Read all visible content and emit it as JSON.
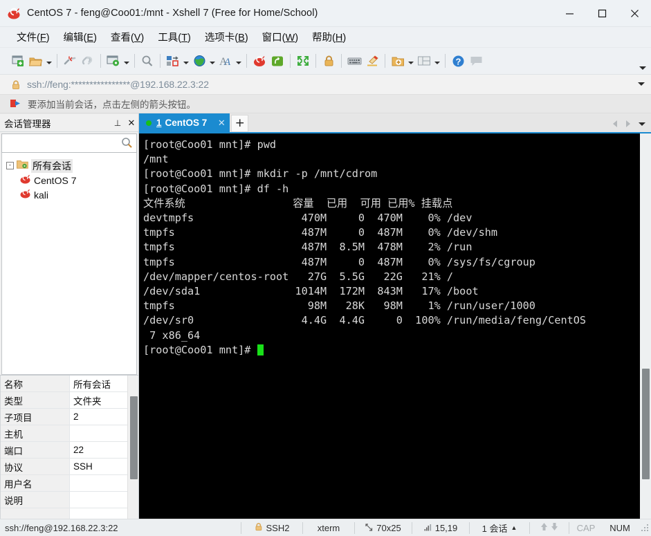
{
  "window": {
    "title": "CentOS 7 - feng@Coo01:/mnt - Xshell 7 (Free for Home/School)",
    "app_icon": "snail-icon",
    "minimize": "—",
    "maximize": "□",
    "close": "✕"
  },
  "menubar": {
    "items": [
      {
        "label": "文件(F)",
        "pre": "文件(",
        "key": "F",
        "post": ")"
      },
      {
        "label": "编辑(E)",
        "pre": "编辑(",
        "key": "E",
        "post": ")"
      },
      {
        "label": "查看(V)",
        "pre": "查看(",
        "key": "V",
        "post": ")"
      },
      {
        "label": "工具(T)",
        "pre": "工具(",
        "key": "T",
        "post": ")"
      },
      {
        "label": "选项卡(B)",
        "pre": "选项卡(",
        "key": "B",
        "post": ")"
      },
      {
        "label": "窗口(W)",
        "pre": "窗口(",
        "key": "W",
        "post": ")"
      },
      {
        "label": "帮助(H)",
        "pre": "帮助(",
        "key": "H",
        "post": ")"
      }
    ]
  },
  "toolbar": {
    "buttons": [
      "new-session-icon",
      "open-folder-icon",
      "open-folder-dropdown",
      "disconnect-icon",
      "reconnect-icon",
      "session-properties-icon",
      "session-properties-dropdown",
      "layout-arrange-icon",
      "layout-arrange-dropdown",
      "globe-encoding-icon",
      "globe-encoding-dropdown",
      "font-icon",
      "font-dropdown",
      "xshell-snail-icon",
      "xftp-icon",
      "fullscreen-icon",
      "lock-icon",
      "keyboard-icon",
      "highlight-pen-icon",
      "new-folder-icon",
      "new-folder-dropdown",
      "split-view-icon",
      "split-view-dropdown",
      "help-icon",
      "feedback-icon"
    ],
    "overflow_icon": "chevron-down-icon"
  },
  "address_bar": {
    "lock_icon": "lock-icon",
    "value": "ssh://feng:****************@192.168.22.3:22",
    "dropdown_icon": "chevron-down-icon"
  },
  "hint_bar": {
    "icon": "arrow-flag-icon",
    "text": "要添加当前会话，点击左侧的箭头按钮。"
  },
  "session_manager": {
    "header_title": "会话管理器",
    "pin_icon": "pin-icon",
    "close_icon": "close-icon",
    "search_placeholder": "",
    "search_value": "",
    "search_icon": "search-icon",
    "tree": {
      "root": {
        "label": "所有会话",
        "icon": "folder-sessions-icon",
        "expander": "-"
      },
      "children": [
        {
          "label": "CentOS 7",
          "icon": "snail-icon"
        },
        {
          "label": "kali",
          "icon": "snail-icon"
        }
      ]
    }
  },
  "properties": {
    "rows": [
      {
        "key": "名称",
        "value": "所有会话"
      },
      {
        "key": "类型",
        "value": "文件夹"
      },
      {
        "key": "子项目",
        "value": "2"
      },
      {
        "key": "主机",
        "value": ""
      },
      {
        "key": "端口",
        "value": "22"
      },
      {
        "key": "协议",
        "value": "SSH"
      },
      {
        "key": "用户名",
        "value": ""
      },
      {
        "key": "说明",
        "value": ""
      },
      {
        "key": "",
        "value": ""
      }
    ]
  },
  "tabs": {
    "items": [
      {
        "number": "1",
        "label": "CentOS 7",
        "status_dot": "#18c018",
        "close_icon": "✕",
        "active": true
      }
    ],
    "new_tab_label": "+",
    "nav_left_icon": "chevron-left-icon",
    "nav_right_icon": "chevron-right-icon",
    "tab_list_icon": "chevron-down-icon"
  },
  "terminal": {
    "prompt": "[root@Coo01 mnt]#",
    "lines": [
      "[root@Coo01 mnt]# pwd",
      "/mnt",
      "[root@Coo01 mnt]# mkdir -p /mnt/cdrom",
      "[root@Coo01 mnt]# df -h",
      "文件系统                 容量  已用  可用 已用% 挂载点",
      "devtmpfs                 470M     0  470M    0% /dev",
      "tmpfs                    487M     0  487M    0% /dev/shm",
      "tmpfs                    487M  8.5M  478M    2% /run",
      "tmpfs                    487M     0  487M    0% /sys/fs/cgroup",
      "/dev/mapper/centos-root   27G  5.5G   22G   21% /",
      "/dev/sda1               1014M  172M  843M   17% /boot",
      "tmpfs                     98M   28K   98M    1% /run/user/1000",
      "/dev/sr0                 4.4G  4.4G     0  100% /run/media/feng/CentOS",
      " 7 x86_64"
    ],
    "last_line": "[root@Coo01 mnt]# ",
    "cursor_color": "#19e019",
    "fg_color": "#d8d8d8",
    "bg_color": "#000000",
    "df_table": {
      "headers": [
        "文件系统",
        "容量",
        "已用",
        "可用",
        "已用%",
        "挂载点"
      ],
      "rows": [
        [
          "devtmpfs",
          "470M",
          "0",
          "470M",
          "0%",
          "/dev"
        ],
        [
          "tmpfs",
          "487M",
          "0",
          "487M",
          "0%",
          "/dev/shm"
        ],
        [
          "tmpfs",
          "487M",
          "8.5M",
          "478M",
          "2%",
          "/run"
        ],
        [
          "tmpfs",
          "487M",
          "0",
          "487M",
          "0%",
          "/sys/fs/cgroup"
        ],
        [
          "/dev/mapper/centos-root",
          "27G",
          "5.5G",
          "22G",
          "21%",
          "/"
        ],
        [
          "/dev/sda1",
          "1014M",
          "172M",
          "843M",
          "17%",
          "/boot"
        ],
        [
          "tmpfs",
          "98M",
          "28K",
          "98M",
          "1%",
          "/run/user/1000"
        ],
        [
          "/dev/sr0",
          "4.4G",
          "4.4G",
          "0",
          "100%",
          "/run/media/feng/CentOS 7 x86_64"
        ]
      ]
    }
  },
  "statusbar": {
    "url": "ssh://feng@192.168.22.3:22",
    "security_icon": "lock-icon",
    "security": "SSH2",
    "term_type": "xterm",
    "size_icon": "screen-size-icon",
    "size": "70x25",
    "cursor_icon": "cursor-pos-icon",
    "cursor_pos": "15,19",
    "sessions": "1 会话",
    "sessions_caret": "▲",
    "tx_icon": "upload-arrow-icon",
    "rx_icon": "download-arrow-icon",
    "caps": "CAP",
    "num": "NUM"
  },
  "colors": {
    "accent_blue": "#1b8bd0",
    "chrome": "#eef1f4",
    "terminal_bg": "#000000",
    "terminal_fg": "#d8d8d8",
    "green_dot": "#18c018"
  }
}
